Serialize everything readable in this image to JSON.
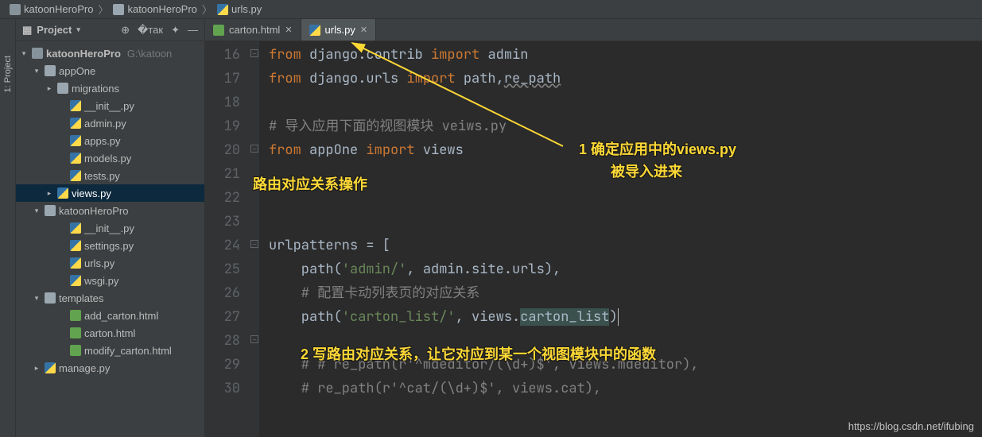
{
  "breadcrumb": {
    "root": "katoonHeroPro",
    "sub": "katoonHeroPro",
    "file": "urls.py"
  },
  "vtab": {
    "label": "1: Project"
  },
  "toolWindow": {
    "title": "Project"
  },
  "tree": {
    "root": {
      "name": "katoonHeroPro",
      "hint": "G:\\katoon"
    },
    "appOne": "appOne",
    "migrations": "migrations",
    "files_app": [
      "__init__.py",
      "admin.py",
      "apps.py",
      "models.py",
      "tests.py",
      "views.py"
    ],
    "pkg": "katoonHeroPro",
    "files_pkg": [
      "__init__.py",
      "settings.py",
      "urls.py",
      "wsgi.py"
    ],
    "templates": "templates",
    "files_tpl": [
      "add_carton.html",
      "carton.html",
      "modify_carton.html"
    ],
    "manage": "manage.py"
  },
  "tabs": {
    "t0": "carton.html",
    "t1": "urls.py",
    "active": 1
  },
  "gutter": [
    "16",
    "17",
    "18",
    "19",
    "20",
    "21",
    "22",
    "23",
    "24",
    "25",
    "26",
    "27",
    "28",
    "29",
    "30"
  ],
  "code": {
    "l16": {
      "kw1": "from",
      "m": "django.contrib",
      "kw2": "import",
      "n": "admin"
    },
    "l17": {
      "kw1": "from",
      "m": "django.urls",
      "kw2": "import",
      "n": "path",
      "n2": "re_path"
    },
    "l19": {
      "c": "# 导入应用下面的视图模块 veiws.py"
    },
    "l20": {
      "kw1": "from",
      "m": "appOne",
      "kw2": "import",
      "n": "views"
    },
    "l24": {
      "t": "urlpatterns = ["
    },
    "l25": {
      "p": "    path(",
      "s": "'admin/'",
      "r": ", admin.site.urls),"
    },
    "l26": {
      "c": "    # 配置卡动列表页的对应关系"
    },
    "l27": {
      "p": "    path(",
      "s": "'carton_list/'",
      "r": ", views.",
      "hl": "carton_list",
      "end": ")"
    },
    "l29": {
      "c": "    # # re_path(r'^mdeditor/(\\d+)$', views.mdeditor),"
    },
    "l30": {
      "c": "    # re_path(r'^cat/(\\d+)$', views.cat),"
    }
  },
  "annotations": {
    "a1_l1": "1 确定应用中的views.py",
    "a1_l2": "被导入进来",
    "a2": "路由对应关系操作",
    "a3": "2 写路由对应关系，让它对应到某一个视图模块中的函数"
  },
  "watermark": "https://blog.csdn.net/ifubing",
  "chart_data": null
}
